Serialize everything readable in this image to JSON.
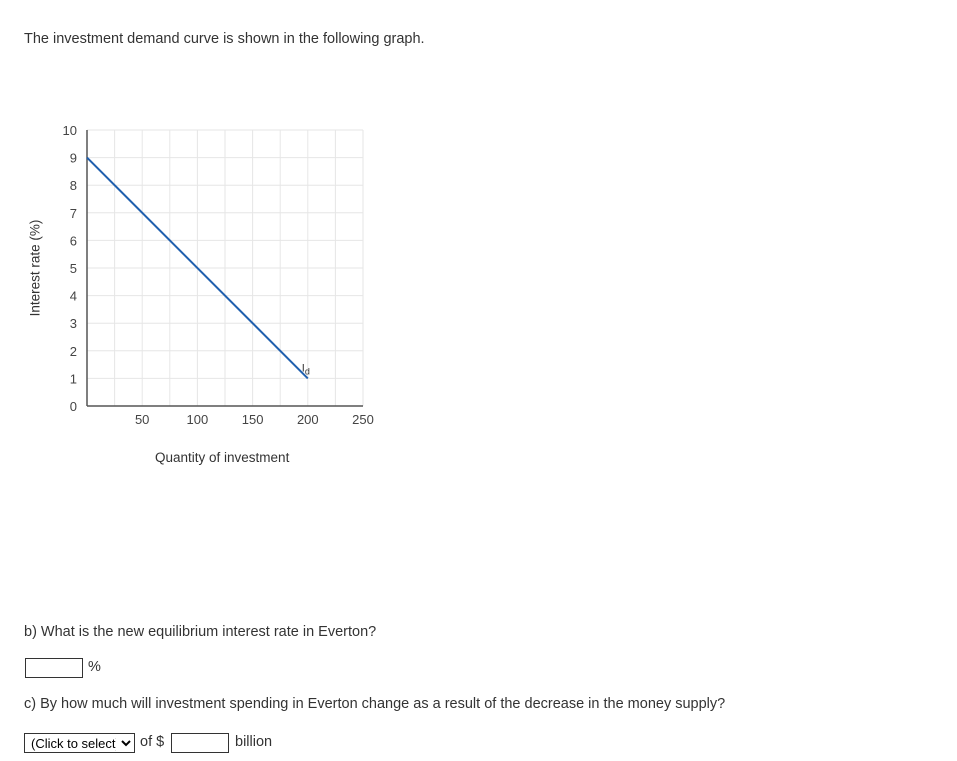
{
  "intro": "The investment demand curve is shown in the following graph.",
  "chart_data": {
    "type": "line",
    "xlabel": "Quantity of investment",
    "ylabel": "Interest rate (%)",
    "xlim": [
      0,
      250
    ],
    "ylim": [
      0,
      10
    ],
    "xticks": [
      50,
      100,
      150,
      200,
      250
    ],
    "yticks": [
      0,
      1,
      2,
      3,
      4,
      5,
      6,
      7,
      8,
      9,
      10
    ],
    "grid": true,
    "series": [
      {
        "name": "Id",
        "color": "#1f5fae",
        "points": [
          [
            0,
            9
          ],
          [
            200,
            1
          ]
        ]
      }
    ]
  },
  "question_b": {
    "text": "b) What is the new equilibrium interest rate in Everton?",
    "input_value": "",
    "unit": "%"
  },
  "question_c": {
    "text": "c) By how much will investment spending in Everton change as a result of the decrease in the money supply?",
    "select_value": "(Click to select)",
    "of_label": "of $",
    "input_value": "",
    "unit": "billion"
  }
}
